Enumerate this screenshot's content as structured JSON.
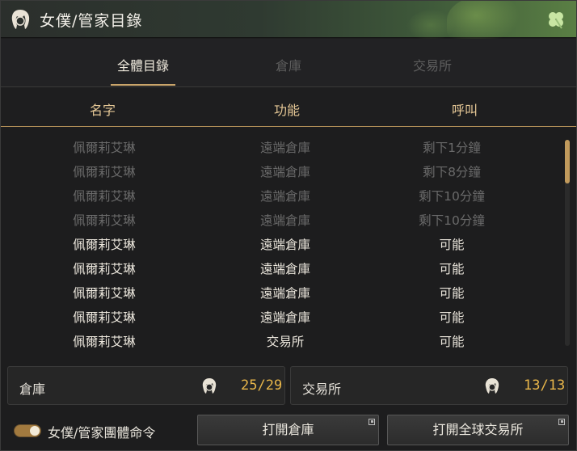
{
  "window": {
    "title": "女僕/管家目錄"
  },
  "tabs": [
    {
      "label": "全體目錄",
      "active": true
    },
    {
      "label": "倉庫",
      "active": false
    },
    {
      "label": "交易所",
      "active": false
    }
  ],
  "columns": {
    "name": "名字",
    "function": "功能",
    "call": "呼叫"
  },
  "rows": [
    {
      "name": "佩爾莉艾琳",
      "function": "遠端倉庫",
      "call": "剩下1分鐘",
      "state": "cooldown"
    },
    {
      "name": "佩爾莉艾琳",
      "function": "遠端倉庫",
      "call": "剩下8分鐘",
      "state": "cooldown"
    },
    {
      "name": "佩爾莉艾琳",
      "function": "遠端倉庫",
      "call": "剩下10分鐘",
      "state": "cooldown"
    },
    {
      "name": "佩爾莉艾琳",
      "function": "遠端倉庫",
      "call": "剩下10分鐘",
      "state": "cooldown"
    },
    {
      "name": "佩爾莉艾琳",
      "function": "遠端倉庫",
      "call": "可能",
      "state": "available"
    },
    {
      "name": "佩爾莉艾琳",
      "function": "遠端倉庫",
      "call": "可能",
      "state": "available"
    },
    {
      "name": "佩爾莉艾琳",
      "function": "遠端倉庫",
      "call": "可能",
      "state": "available"
    },
    {
      "name": "佩爾莉艾琳",
      "function": "遠端倉庫",
      "call": "可能",
      "state": "available"
    },
    {
      "name": "佩爾莉艾琳",
      "function": "交易所",
      "call": "可能",
      "state": "available"
    }
  ],
  "summary": {
    "warehouse": {
      "label": "倉庫",
      "value": "25/29",
      "icon": "maid-icon"
    },
    "market": {
      "label": "交易所",
      "value": "13/13",
      "icon": "maid-icon"
    }
  },
  "footer": {
    "toggle_label": "女僕/管家團體命令",
    "toggle_on": true,
    "open_warehouse": "打開倉庫",
    "open_market": "打開全球交易所"
  },
  "colors": {
    "accent": "#c9a46a",
    "value": "#e8b64a",
    "header": "#e6c896"
  }
}
